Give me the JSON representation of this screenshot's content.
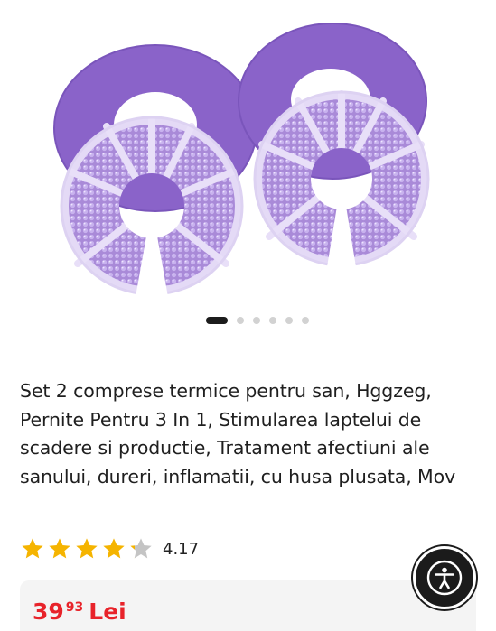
{
  "product": {
    "title": "Set 2 comprese termice pentru san, Hggzeg, Pernite Pentru 3 In 1, Stimularea laptelui de scadere si productie, Tratament afectiuni ale sanului, dureri, inflamatii, cu husa plusata, Mov",
    "rating": {
      "value": "4.17",
      "stars_filled_fraction": 0.834
    },
    "price": {
      "integer": "39",
      "decimals": "93",
      "currency": "Lei"
    }
  },
  "gallery": {
    "image_count": 6,
    "active_index": 0
  },
  "colors": {
    "price": "#e8232a",
    "star_filled": "#f5b400",
    "star_empty": "#c4c4c4",
    "accent_purple": "#8a63c9"
  },
  "icons": {
    "accessibility": "accessibility-icon",
    "star": "star-icon"
  }
}
